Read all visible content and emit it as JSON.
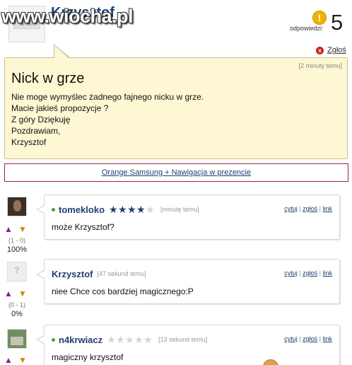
{
  "watermark": "www.wiocha.pl",
  "asker": {
    "name": "Krzysztof",
    "avatar_label": "samosia"
  },
  "answers_meta": {
    "badge": "!",
    "label": "odpowiedzi:",
    "count": "5"
  },
  "report": {
    "label": "Zgłoś",
    "icon": "x"
  },
  "question": {
    "time": "[2 minuty temu]",
    "title": "Nick w grze",
    "lines": [
      "Nie moge wymyślec żadnego fajnego nicku w grze.",
      "Macie jakieś propozycje ?",
      "Z góry Dziękuję",
      "Pozdrawiam,",
      "Krzysztof"
    ]
  },
  "ad": {
    "text": "Orange Samsung + Nawigacja w prezencie"
  },
  "answers": [
    {
      "user": "tomekloko",
      "online": true,
      "rating": 3.5,
      "time": "[minutę temu]",
      "text": "może Krzysztof?",
      "score": "(1 - 0)",
      "percent": "100%"
    },
    {
      "user": "Krzysztof",
      "online": false,
      "time": "[47 sekund temu]",
      "text": "niee Chce cos bardziej magicznego:P",
      "score": "(0 - 1)",
      "percent": "0%"
    },
    {
      "user": "n4krwiacz",
      "online": true,
      "rating": 0,
      "time": "[13 sekund temu]",
      "text": "magiczny krzysztof",
      "score": "",
      "percent": ""
    }
  ],
  "actions": {
    "quote": "cytuj",
    "report": "zgłoś",
    "link": "link",
    "sep": "|"
  },
  "colors": {
    "username": "#1f3e72",
    "question_bg": "#fdf7d3",
    "ad_border": "#9e2733",
    "badge": "#f0b300"
  }
}
